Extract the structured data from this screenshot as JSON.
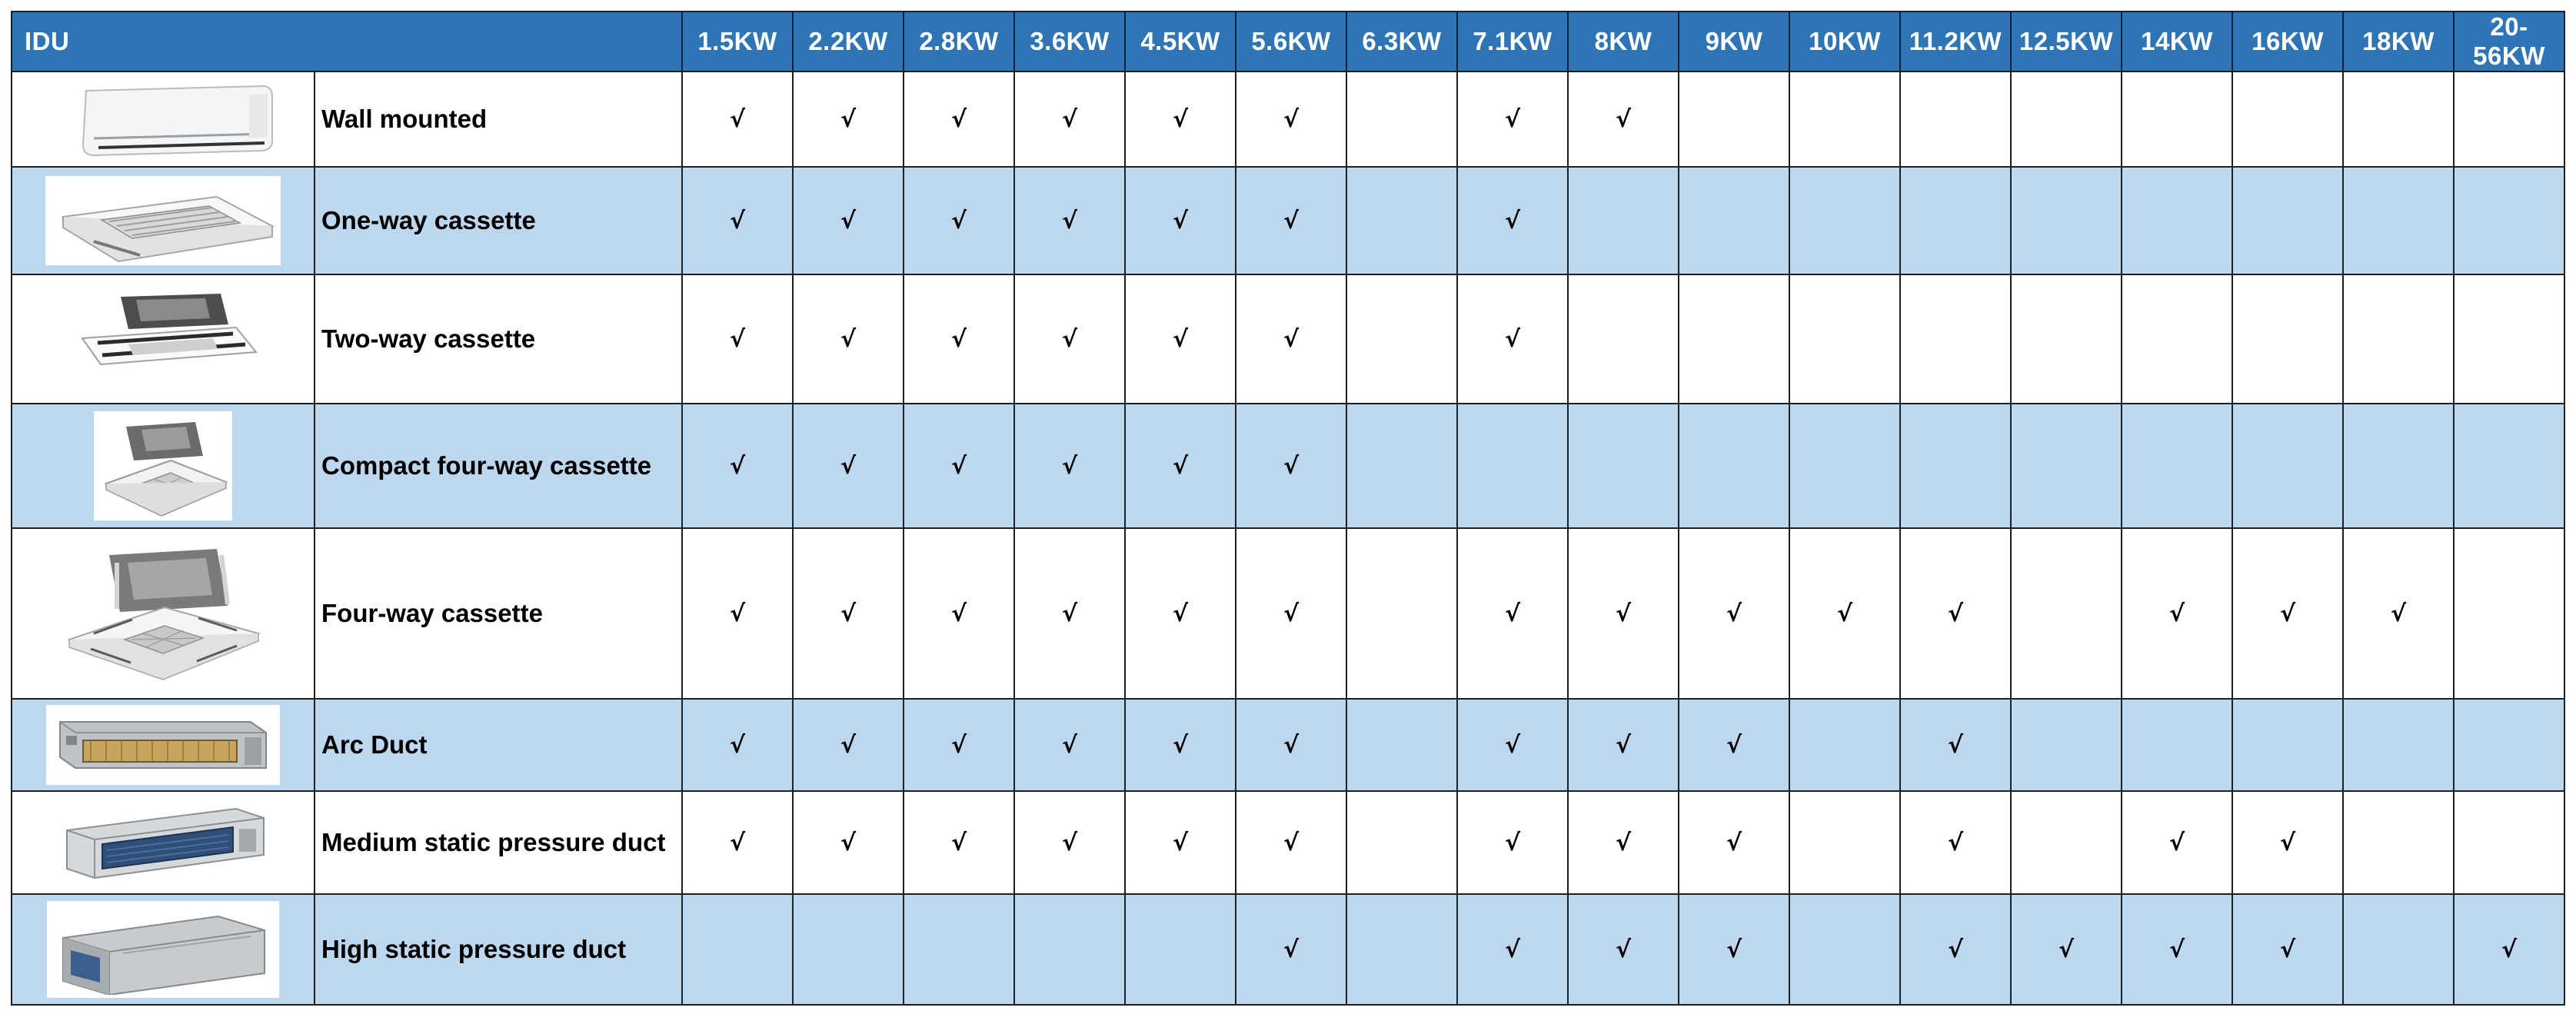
{
  "table": {
    "header": {
      "idu": "IDU",
      "capacities": [
        "1.5KW",
        "2.2KW",
        "2.8KW",
        "3.6KW",
        "4.5KW",
        "5.6KW",
        "6.3KW",
        "7.1KW",
        "8KW",
        "9KW",
        "10KW",
        "11.2KW",
        "12.5KW",
        "14KW",
        "16KW",
        "18KW",
        "20-56KW"
      ]
    },
    "check_symbol": "√",
    "rows": [
      {
        "name": "Wall mounted",
        "icon": "wall-mounted-unit-image",
        "checks": [
          1,
          1,
          1,
          1,
          1,
          1,
          0,
          1,
          1,
          0,
          0,
          0,
          0,
          0,
          0,
          0,
          0
        ]
      },
      {
        "name": "One-way cassette",
        "icon": "one-way-cassette-image",
        "checks": [
          1,
          1,
          1,
          1,
          1,
          1,
          0,
          1,
          0,
          0,
          0,
          0,
          0,
          0,
          0,
          0,
          0
        ]
      },
      {
        "name": "Two-way cassette",
        "icon": "two-way-cassette-image",
        "checks": [
          1,
          1,
          1,
          1,
          1,
          1,
          0,
          1,
          0,
          0,
          0,
          0,
          0,
          0,
          0,
          0,
          0
        ]
      },
      {
        "name": "Compact four-way cassette",
        "icon": "compact-four-way-cassette-image",
        "checks": [
          1,
          1,
          1,
          1,
          1,
          1,
          0,
          0,
          0,
          0,
          0,
          0,
          0,
          0,
          0,
          0,
          0
        ]
      },
      {
        "name": "Four-way cassette",
        "icon": "four-way-cassette-image",
        "checks": [
          1,
          1,
          1,
          1,
          1,
          1,
          0,
          1,
          1,
          1,
          1,
          1,
          0,
          1,
          1,
          1,
          0
        ]
      },
      {
        "name": "Arc Duct",
        "icon": "arc-duct-image",
        "checks": [
          1,
          1,
          1,
          1,
          1,
          1,
          0,
          1,
          1,
          1,
          0,
          1,
          0,
          0,
          0,
          0,
          0
        ]
      },
      {
        "name": "Medium static pressure duct",
        "icon": "medium-static-duct-image",
        "checks": [
          1,
          1,
          1,
          1,
          1,
          1,
          0,
          1,
          1,
          1,
          0,
          1,
          0,
          1,
          1,
          0,
          0
        ]
      },
      {
        "name": "High static pressure duct",
        "icon": "high-static-duct-image",
        "checks": [
          0,
          0,
          0,
          0,
          0,
          1,
          0,
          1,
          1,
          1,
          0,
          1,
          1,
          1,
          1,
          0,
          1
        ]
      }
    ],
    "colors": {
      "header": "#2f75b5",
      "alt_row": "#bdd7ee",
      "grid": "#1f1f1f"
    }
  }
}
